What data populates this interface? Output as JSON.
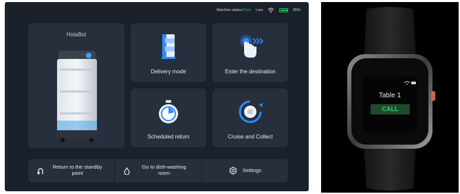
{
  "status_bar": {
    "machine_status_label": "Machine status:",
    "machine_status_value": "Free",
    "bluetooth_label": "Lora",
    "battery_percent": "95%"
  },
  "robot_card": {
    "name": "HolaBot"
  },
  "cards": {
    "delivery": "Delivery mode",
    "destination": "Enter the destination",
    "scheduled": "Scheduled return",
    "cruise": "Cruise and Collect"
  },
  "bottom_bar": {
    "standby": "Return to the standby point",
    "dishwashing": "Go to dish-washing room",
    "settings": "Settings"
  },
  "watch": {
    "title": "Table 1",
    "call_label": "CALL"
  },
  "colors": {
    "tablet_bg": "#1a212b",
    "card_bg": "#262f3b",
    "status_free": "#22c55e",
    "accent_blue": "#2f8bff",
    "watch_call_text": "#25d366"
  }
}
